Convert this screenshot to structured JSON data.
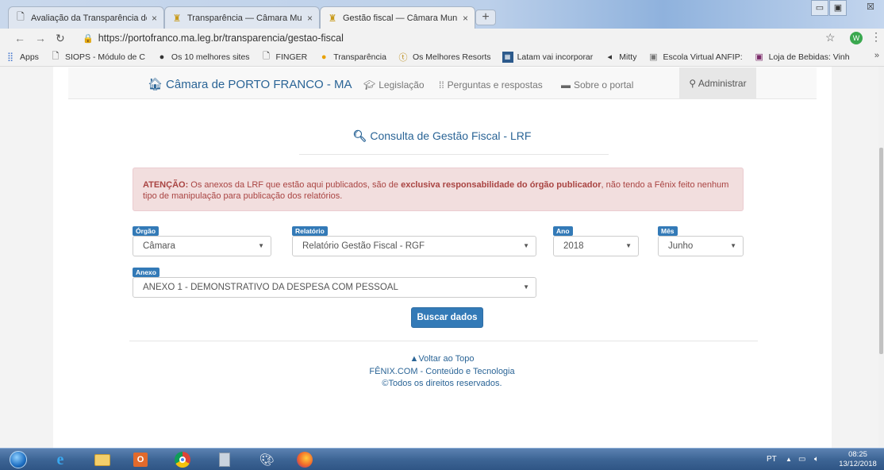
{
  "browser": {
    "tabs": [
      {
        "title": "Avaliação da Transparência dos I",
        "favicon": "page-icon",
        "active": false
      },
      {
        "title": "Transparência — Câmara Municip",
        "favicon": "camara-crest-icon",
        "active": false
      },
      {
        "title": "Gestão fiscal — Câmara Municip",
        "favicon": "camara-crest-icon",
        "active": true
      }
    ],
    "tab_close_glyph": "×",
    "new_tab_glyph": "+",
    "window_controls": {
      "minimize": "▭",
      "maximize": "▣",
      "close": "☒"
    },
    "url": "https://portofranco.ma.leg.br/transparencia/gestao-fiscal",
    "profile_initial": "W",
    "bookmarks": [
      {
        "label": "Apps",
        "icon": "apps-grid-icon"
      },
      {
        "label": "SIOPS - Módulo de C",
        "icon": "page-icon"
      },
      {
        "label": "Os 10 melhores sites",
        "icon": "circle-logo-icon"
      },
      {
        "label": "FINGER",
        "icon": "page-icon"
      },
      {
        "label": "Transparência",
        "icon": "info-badge-icon"
      },
      {
        "label": "Os Melhores Resorts",
        "icon": "resort-logo-icon"
      },
      {
        "label": "Latam vai incorporar",
        "icon": "news-logo-icon"
      },
      {
        "label": "Mitty",
        "icon": "mitty-logo-icon"
      },
      {
        "label": "Escola Virtual ANFIP:",
        "icon": "school-logo-icon"
      },
      {
        "label": "Loja de Bebidas: Vinh",
        "icon": "shop-logo-icon"
      }
    ],
    "bookmarks_more": "»"
  },
  "navbar": {
    "brand": "Câmara de PORTO FRANCO - MA",
    "links": [
      {
        "label": "Legislação",
        "icon": "graduation-cap-icon"
      },
      {
        "label": "Perguntas e respostas",
        "icon": "sitemap-icon"
      },
      {
        "label": "Sobre o portal",
        "icon": "monitor-icon"
      }
    ],
    "admin": "Administrar"
  },
  "consulta": {
    "title": "Consulta de Gestão Fiscal - LRF"
  },
  "alert": {
    "strong_prefix": "ATENÇÃO:",
    "text_1": " Os anexos da LRF que estão aqui publicados, são de ",
    "strong_mid": "exclusiva responsabilidade do órgão publicador",
    "text_2": ", não tendo a Fênix feito nenhum tipo de manipulação para publicação dos relatórios."
  },
  "form": {
    "orgao": {
      "label": "Órgão",
      "value": "Câmara"
    },
    "relatorio": {
      "label": "Relatório",
      "value": "Relatório Gestão Fiscal - RGF"
    },
    "ano": {
      "label": "Ano",
      "value": "2018"
    },
    "mes": {
      "label": "Mês",
      "value": "Junho"
    },
    "anexo": {
      "label": "Anexo",
      "value": "ANEXO 1 - DEMONSTRATIVO DA DESPESA COM PESSOAL"
    },
    "caret": "▼",
    "submit": "Buscar dados"
  },
  "footer": {
    "back_to_top": "Voltar ao Topo",
    "company": "FÊNIX.COM - Conteúdo e Tecnologia",
    "rights": "©Todos os direitos reservados."
  },
  "taskbar": {
    "language": "PT",
    "tray_arrow": "▲",
    "time": "08:25",
    "date": "13/12/2018"
  },
  "colors": {
    "link": "#2a6496",
    "primary": "#337ab7",
    "alert_bg": "#f2dede",
    "alert_text": "#a94442"
  }
}
